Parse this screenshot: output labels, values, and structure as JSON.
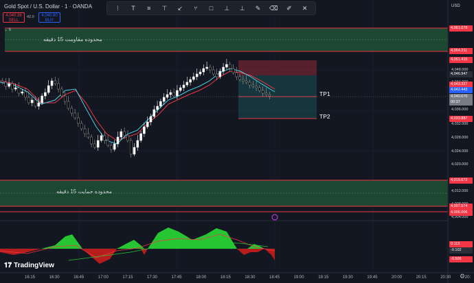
{
  "header": {
    "title": "Gold Spot / U.S. Dollar · 1 · OANDA",
    "sell_price": "4,040.38",
    "sell_label": "SELL",
    "buy_price": "4,040.80",
    "buy_label": "BUY",
    "spread": "42.0",
    "indicator_count": "6"
  },
  "toolbar": {
    "tools": [
      "cursor-icon",
      "text-icon",
      "fib-icon",
      "measure-icon",
      "arrow-icon",
      "pitchfork-icon",
      "rectangle-icon",
      "path-icon",
      "pin-icon",
      "brush-icon",
      "eraser-icon",
      "sticker-icon",
      "close-icon"
    ]
  },
  "price_axis": {
    "currency": "USD",
    "labels": [
      "4,048.000",
      "4,044.000",
      "4,040.000",
      "4,036.000",
      "4,032.000",
      "4,028.000",
      "4,024.000",
      "4,020.000",
      "4,012.000",
      "4,008.000",
      "4,004.000"
    ],
    "tags": [
      {
        "text": "4,061.078",
        "color": "#f23645"
      },
      {
        "text": "4,054.211",
        "color": "#f23645"
      },
      {
        "text": "4,051.415",
        "color": "#f23645"
      },
      {
        "text": "4,046.947",
        "color": "#2a2e39"
      },
      {
        "text": "4,043.327",
        "color": "#f23645"
      },
      {
        "text": "4,042.443",
        "color": "#2962ff"
      },
      {
        "text": "4,040.670",
        "color": "#787b86"
      },
      {
        "text": "00:37",
        "color": "#787b86"
      },
      {
        "text": "4,033.887",
        "color": "#f23645"
      },
      {
        "text": "4,015.672",
        "color": "#f23645"
      },
      {
        "text": "4,007.574",
        "color": "#f23645"
      },
      {
        "text": "4,006.006",
        "color": "#f23645"
      }
    ]
  },
  "oscillator_axis": {
    "tags": [
      {
        "text": "0.113",
        "color": "#f23645"
      },
      {
        "text": "-0.102",
        "color": "#2a2e39"
      },
      {
        "text": "-0.505",
        "color": "#f23645"
      }
    ]
  },
  "time_axis": {
    "labels": [
      "16:15",
      "16:30",
      "16:45",
      "17:00",
      "17:15",
      "17:30",
      "17:45",
      "18:00",
      "18:15",
      "18:30",
      "18:45",
      "19:00",
      "19:15",
      "19:30",
      "19:45",
      "20:00",
      "20:15",
      "20:30",
      "20:"
    ]
  },
  "zones": {
    "resistance_text": "محدوده مقاومت 15 دقیقه",
    "support_text": "محدوده حمایت 15 دقیقه"
  },
  "targets": {
    "tp1": "TP1",
    "tp2": "TP2"
  },
  "branding": {
    "logo_text": "TradingView"
  },
  "colors": {
    "background": "#131722",
    "zone_fill": "#1e4d33",
    "zone_border": "#f23645",
    "bull_candle": "#ffffff",
    "ma_red": "#f23645",
    "ma_cyan": "#4dd0e1",
    "osc_green": "#26c632",
    "osc_red": "#b71c1c"
  }
}
